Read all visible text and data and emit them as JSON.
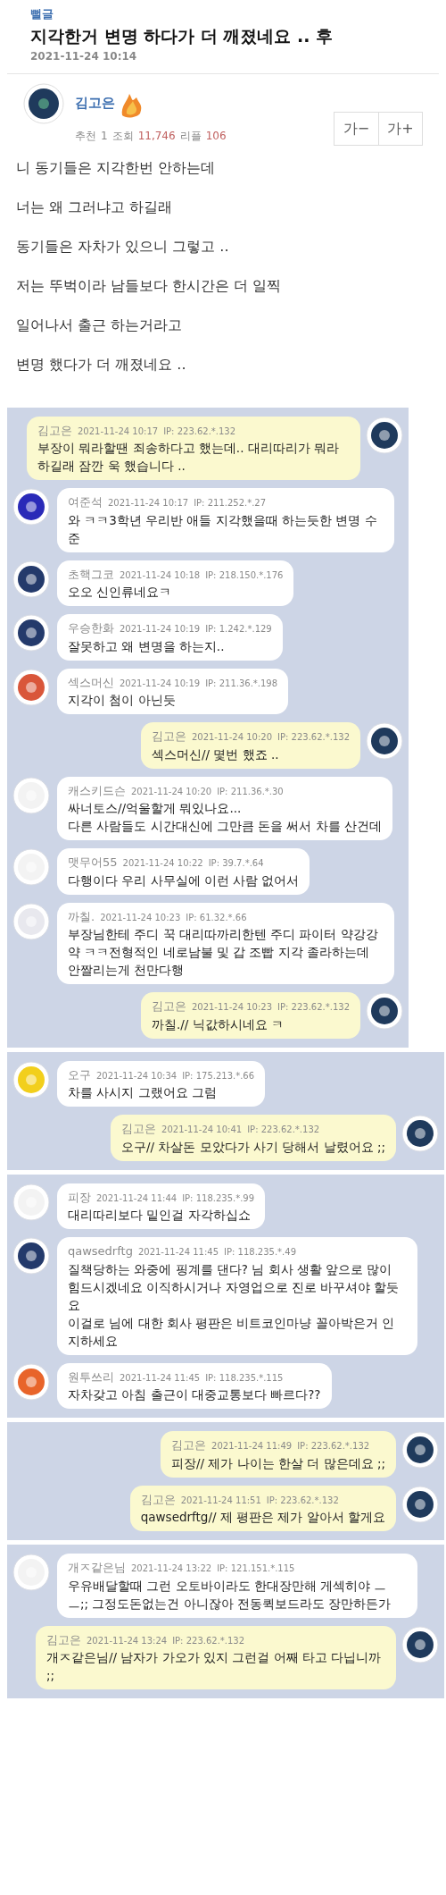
{
  "post": {
    "category": "뻘글",
    "title": "지각한거 변명 하다가 더 깨졌네요 .. 후",
    "date": "2021-11-24 10:14",
    "author": "김고은",
    "stats": [
      {
        "label": "추천",
        "value": "1",
        "highlight": false
      },
      {
        "label": "조회",
        "value": "11,746",
        "highlight": true
      },
      {
        "label": "리플",
        "value": "106",
        "highlight": true
      }
    ],
    "font_buttons": [
      "가−",
      "가+"
    ],
    "body": [
      "니 동기들은 지각한번 안하는데",
      "너는 왜 그러냐고 하길래",
      "동기들은 자차가 있으니 그렇고 ..",
      "저는 뚜벅이라 남들보다 한시간은 더 일찍",
      "일어나서 출근 하는거라고",
      "변명 했다가 더 깨졌네요 .."
    ]
  },
  "panels": [
    {
      "wide": false,
      "comments": [
        {
          "kind": "mine",
          "name": "김고은",
          "time": "2021-11-24 10:17",
          "ip": "IP: 223.62.*.132",
          "text": "부장이 뭐라할땐 죄송하다고 했는데.. 대리따리가 뭐라 하길래 잠깐 욱 했습니다 ..",
          "color": "#1f3a5c"
        },
        {
          "kind": "other",
          "name": "여준석",
          "time": "2021-11-24 10:17",
          "ip": "IP: 211.252.*.27",
          "text": "와 ㅋㅋ3학년 우리반 애들 지각했을때 하는듯한 변명 수준",
          "color": "#2a2ab8"
        },
        {
          "kind": "other",
          "name": "초핵그코",
          "time": "2021-11-24 10:18",
          "ip": "IP: 218.150.*.176",
          "text": "오오 신인류네요ㅋ",
          "color": "#243a6b"
        },
        {
          "kind": "other",
          "name": "우승한화",
          "time": "2021-11-24 10:19",
          "ip": "IP: 1.242.*.129",
          "text": "잘못하고 왜 변명을 하는지..",
          "color": "#243a6b"
        },
        {
          "kind": "other",
          "name": "섹스머신",
          "time": "2021-11-24 10:19",
          "ip": "IP: 211.36.*.198",
          "text": "지각이 첨이 아닌듯",
          "color": "#d9563a"
        },
        {
          "kind": "mine",
          "name": "김고은",
          "time": "2021-11-24 10:20",
          "ip": "IP: 223.62.*.132",
          "text": "섹스머신// 몇번 했죠 ..",
          "color": "#1f3a5c"
        },
        {
          "kind": "other",
          "name": "캐스키드슨",
          "time": "2021-11-24 10:20",
          "ip": "IP: 211.36.*.30",
          "text": "싸너토스//억울할게 뭐있나요...\n다른 사람들도 시간대신에 그만큼 돈을 써서 차를 산건데",
          "color": "#f3f3f3"
        },
        {
          "kind": "other",
          "name": "맷무어55",
          "time": "2021-11-24 10:22",
          "ip": "IP: 39.7.*.64",
          "text": "다행이다 우리 사무실에 이런 사람 없어서",
          "color": "#f3f3f3"
        },
        {
          "kind": "other",
          "name": "까칠.",
          "time": "2021-11-24 10:23",
          "ip": "IP: 61.32.*.66",
          "text": "부장님한테 주디 꾹 대리따까리한텐 주디 파이터 약강강약 ㅋㅋ전형적인 네로남불 및 갑 조빱 지각 졸라하는데 안짤리는게 천만다행",
          "color": "#e8e8ee"
        },
        {
          "kind": "mine",
          "name": "김고은",
          "time": "2021-11-24 10:23",
          "ip": "IP: 223.62.*.132",
          "text": "까칠.// 닉값하시네요 ㅋ",
          "color": "#1f3a5c"
        }
      ]
    },
    {
      "wide": true,
      "comments": [
        {
          "kind": "other",
          "name": "오구",
          "time": "2021-11-24 10:34",
          "ip": "IP: 175.213.*.66",
          "text": "차를 사시지 그랬어요 그럼",
          "color": "#f2cf1c"
        },
        {
          "kind": "mine",
          "name": "김고은",
          "time": "2021-11-24 10:41",
          "ip": "IP: 223.62.*.132",
          "text": "오구// 차살돈 모았다가 사기 당해서 날렸어요 ;;",
          "color": "#1f3a5c"
        }
      ]
    },
    {
      "wide": true,
      "comments": [
        {
          "kind": "other",
          "name": "피장",
          "time": "2021-11-24 11:44",
          "ip": "IP: 118.235.*.99",
          "text": "대리따리보다 밑인걸 자각하십쇼",
          "color": "#f3f3f3"
        },
        {
          "kind": "other",
          "name": "qawsedrftg",
          "time": "2021-11-24 11:45",
          "ip": "IP: 118.235.*.49",
          "text": "질책당하는 와중에 핑계를 댄다? 님 회사 생활 앞으로 많이 힘드시겠네요 이직하시거나 자영업으로 진로 바꾸셔야 할듯요\n이걸로 님에 대한 회사 평판은 비트코인마냥 꼴아박은거 인지하세요",
          "color": "#243a6b"
        },
        {
          "kind": "other",
          "name": "원투쓰리",
          "time": "2021-11-24 11:45",
          "ip": "IP: 118.235.*.115",
          "text": "자차갖고 아침 출근이 대중교통보다 빠르다??",
          "color": "#e8642a"
        }
      ]
    },
    {
      "wide": true,
      "comments": [
        {
          "kind": "mine",
          "name": "김고은",
          "time": "2021-11-24 11:49",
          "ip": "IP: 223.62.*.132",
          "text": "피장// 제가 나이는 한살 더 많은데요 ;;",
          "color": "#1f3a5c"
        },
        {
          "kind": "mine",
          "name": "김고은",
          "time": "2021-11-24 11:51",
          "ip": "IP: 223.62.*.132",
          "text": "qawsedrftg// 제 평판은 제가 알아서 할게요",
          "color": "#1f3a5c"
        }
      ]
    },
    {
      "wide": true,
      "comments": [
        {
          "kind": "other",
          "name": "개ㅈ같은님",
          "time": "2021-11-24 13:22",
          "ip": "IP: 121.151.*.115",
          "text": "우유배달할때 그런 오토바이라도 한대장만해 게섹히야 ㅡㅡ;; 그정도돈없는건 아니잖아 전동퀵보드라도 장만하든가",
          "color": "#f3f3f3"
        },
        {
          "kind": "mine",
          "name": "김고은",
          "time": "2021-11-24 13:24",
          "ip": "IP: 223.62.*.132",
          "text": "개ㅈ같은님// 남자가 가오가 있지 그런걸 어째 타고 다닙니까 ;;",
          "color": "#1f3a5c"
        }
      ]
    }
  ]
}
